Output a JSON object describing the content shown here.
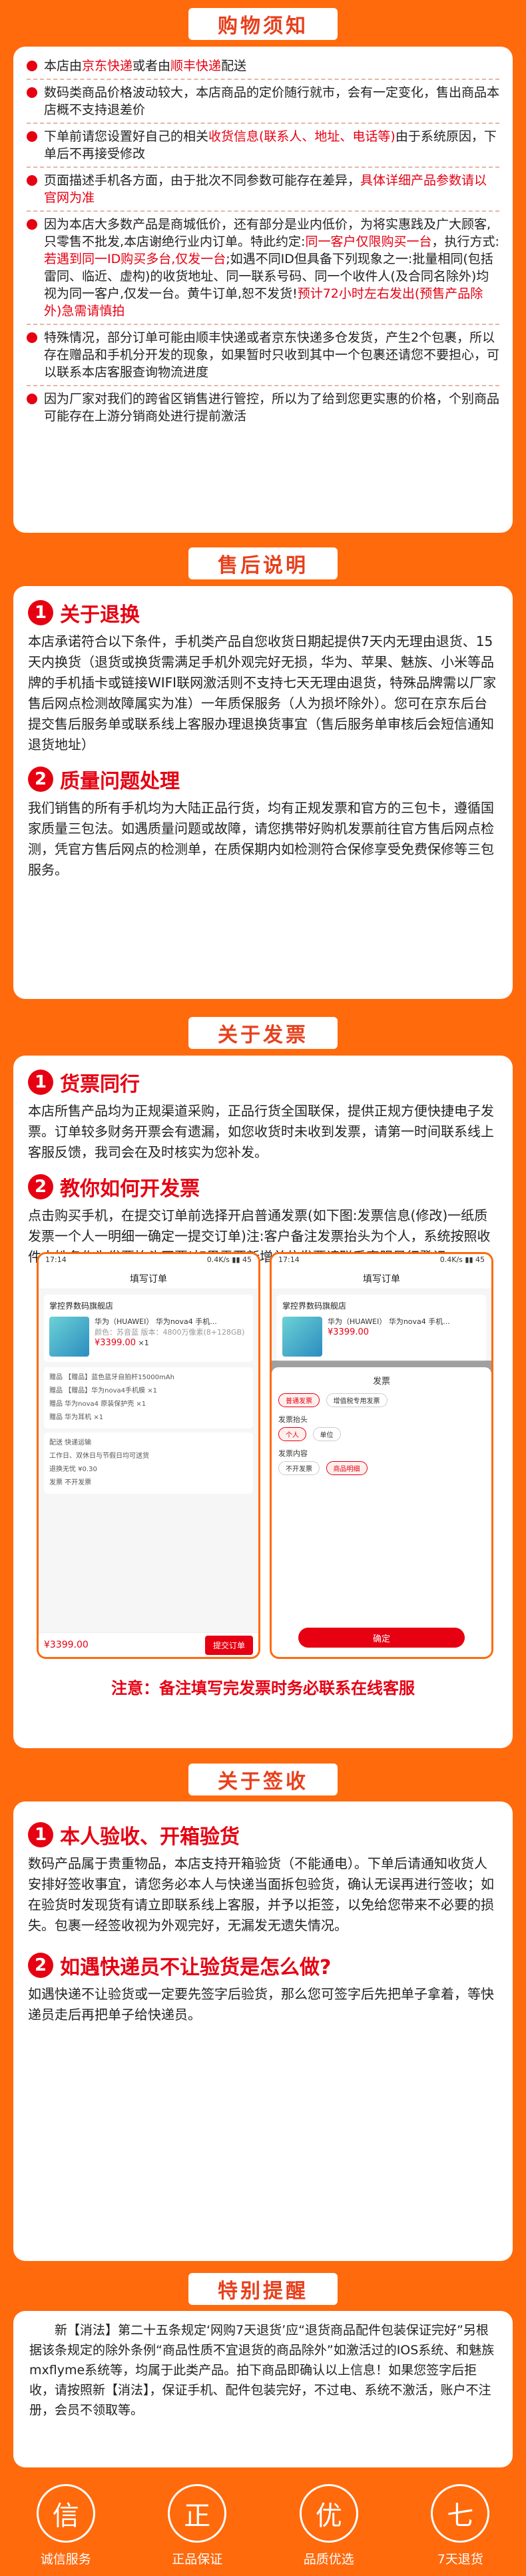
{
  "titles": {
    "notice": "购物须知",
    "after": "售后说明",
    "invoice": "关于发票",
    "sign": "关于签收",
    "special": "特别提醒"
  },
  "notice": {
    "i1_a": "本店由",
    "i1_b": "京东快递",
    "i1_c": "或者由",
    "i1_d": "顺丰快递",
    "i1_e": "配送",
    "i2": "数码类商品价格波动较大，本店商品的定价随行就市，会有一定变化，售出商品本店概不支持退差价",
    "i3_a": "下单前请您设置好自己的相关",
    "i3_b": "收货信息(联系人、地址、电话等)",
    "i3_c": "由于系统原因，下单后不再接受修改",
    "i4_a": "页面描述手机各方面，由于批次不同参数可能存在差异，",
    "i4_b": "具体详细产品参数请以官网为准",
    "i5_a": "因为本店大多数产品是商城低价，还有部分是业内低价，为将实惠践及广大顾客,只零售不批发,本店谢绝行业内订单。特此约定:",
    "i5_b": "同一客户仅限购买一台",
    "i5_c": "，执行方式:",
    "i5_d": "若遇到同一ID购买多台,仅发一台",
    "i5_e": ";如遇不同ID但具备下列现象之一:批量相同(包括雷同、临近、虚构)的收货地址、同一联系号码、同一个收件人(及合同名除外)均视为同一客户,仅发一台。黄牛订单,恕不发货!",
    "i5_f": "预计72小时左右发出(预售产品除外)急需请慎拍",
    "i6": "特殊情况，部分订单可能由顺丰快递或者京东快递多仓发货，产生2个包裹，所以存在赠品和手机分开发的现象，如果暂时只收到其中一个包裹还请您不要担心，可以联系本店客服查询物流进度",
    "i7": "因为厂家对我们的跨省区销售进行管控，所以为了给到您更实惠的价格，个别商品可能存在上游分销商处进行提前激活"
  },
  "after": {
    "h1": "关于退换",
    "p1": "本店承诺符合以下条件，手机类产品自您收货日期起提供7天内无理由退货、15天内换货（退货或换货需满足手机外观完好无损，华为、苹果、魅族、小米等品牌的手机插卡或链接WIFI联网激活则不支持七天无理由退货，特殊品牌需以厂家售后网点检测故障属实为准）一年质保服务（人为损坏除外）。您可在京东后台提交售后服务单或联系线上客服办理退换货事宜（售后服务单审核后会短信通知退货地址）",
    "h2": "质量问题处理",
    "p2": "我们销售的所有手机均为大陆正品行货，均有正规发票和官方的三包卡，遵循国家质量三包法。如遇质量问题或故障，请您携带好购机发票前往官方售后网点检测，凭官方售后网点的检测单，在质保期内如检测符合保修享受免费保修等三包服务。"
  },
  "invoice": {
    "h1": "货票同行",
    "p1": "本店所售产品均为正规渠道采购，正品行货全国联保，提供正规方便快捷电子发票。订单较多财务开票会有遗漏，如您收货时未收到发票，请第一时间联系线上客服反馈，我司会在及时核实为您补发。",
    "h2": "教你如何开发票",
    "p2": "点击购买手机，在提交订单前选择开启普通发票(如下图:发票信息(修改)一纸质发票一个人一明细一确定一提交订单)注:客户备注发票抬头为个人，系统按照收件人姓名作为发票抬头开票!如果需要新增单位发票请联系客服另行登记。",
    "note": "注意：备注填写完发票时务必联系在线客服"
  },
  "shot1": {
    "time": "17:14",
    "status": "0.4K/s ▮▮ 45",
    "title": "填写订单",
    "store": "掌控界数码旗舰店",
    "prod": "华为（HUAWEI） 华为nova4 手机...",
    "spec": "颜色：苏音蓝  版本：4800万像素(8+128GB)",
    "price": "¥3399.00",
    "qty": "×1",
    "l1": "赠品  【赠品】蓝色蓝牙自拍杆15000mAh",
    "l2": "赠品  【赠品】华为nova4手机膜 ×1",
    "l3": "赠品  华为nova4 原装保护壳 ×1",
    "l4": "赠品  华为耳机 ×1",
    "l5": "配送  快递运输",
    "l6": "工作日、双休日与节假日均可送货",
    "l7": "退换无忧  ¥0.30",
    "l8": "发票  不开发票",
    "total": "¥3399.00",
    "btn": "提交订单"
  },
  "shot2": {
    "time": "17:14",
    "status": "0.4K/s ▮▮ 45",
    "title": "填写订单",
    "store": "掌控界数码旗舰店",
    "prod": "华为（HUAWEI） 华为nova4 手机...",
    "price": "¥3399.00",
    "sheet_title": "发票",
    "t1": "普通发票",
    "t2": "增值税专用发票",
    "h_head": "发票抬头",
    "h1": "个人",
    "h2": "单位",
    "h_content": "发票内容",
    "c1": "不开发票",
    "c2": "商品明细",
    "done": "确定"
  },
  "sign": {
    "h1": "本人验收、开箱验货",
    "p1": "数码产品属于贵重物品，本店支持开箱验货（不能通电）。下单后请通知收货人安排好签收事宜，请您务必本人与快递当面拆包验货，确认无误再进行签收；如在验货时发现货有请立即联系线上客服，并予以拒签，以免给您带来不必要的损失。包裹一经签收视为外观完好，无漏发无遗失情况。",
    "h2": "如遇快递员不让验货是怎么做?",
    "p2": "如遇快递不让验货或一定要先签字后验货，那么您可签字后先把单子拿着，等快递员走后再把单子给快递员。"
  },
  "special": {
    "p": "新【消法】第二十五条规定‘网购7天退货’应“退货商品配件包装保证完好”另根据该条规定的除外条例“商品性质不宜退货的商品除外”如激活过的IOS系统、和魅族mxflyme系统等，均属于此类产品。拍下商品即确认以上信息！如果您签字后拒收，请按照新【消法】，保证手机、配件包装完好，不过电、系统不激活，账户不注册，会员不领取等。"
  },
  "features": [
    {
      "icon": "信",
      "label": "诚信服务"
    },
    {
      "icon": "正",
      "label": "正品保证"
    },
    {
      "icon": "优",
      "label": "品质优选"
    },
    {
      "icon": "七",
      "label": "7天退货"
    }
  ]
}
